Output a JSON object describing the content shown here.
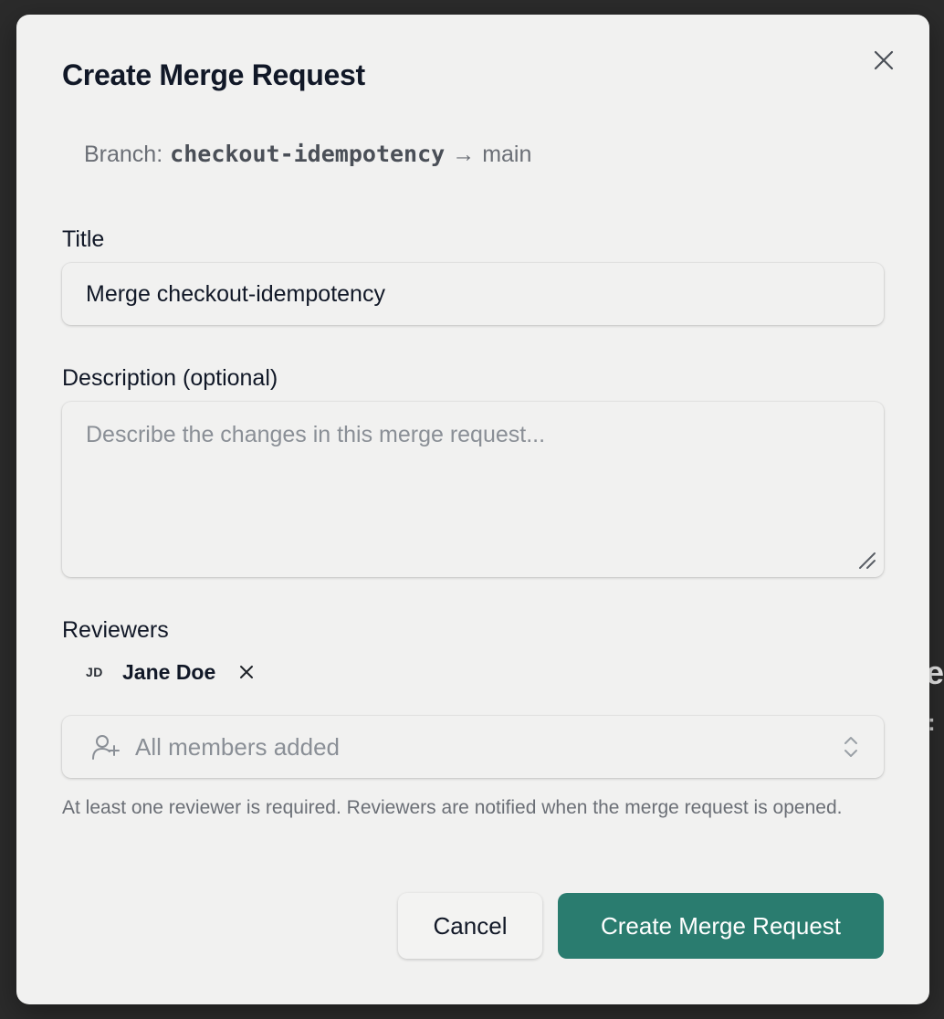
{
  "background": {
    "fragment_1": "e",
    "fragment_2": ": "
  },
  "modal": {
    "title": "Create Merge Request",
    "close_icon": "close-icon",
    "branch": {
      "prefix": "Branch:",
      "source": "checkout-idempotency",
      "arrow": "→",
      "target": "main"
    },
    "title_field": {
      "label": "Title",
      "value": "Merge checkout-idempotency"
    },
    "description_field": {
      "label": "Description (optional)",
      "placeholder": "Describe the changes in this merge request..."
    },
    "reviewers": {
      "label": "Reviewers",
      "selected": [
        {
          "initials": "JD",
          "name": "Jane Doe"
        }
      ],
      "select_placeholder": "All members added",
      "select_icon": "user-plus-icon",
      "help": "At least one reviewer is required. Reviewers are notified when the merge request is opened."
    },
    "actions": {
      "cancel_label": "Cancel",
      "create_label": "Create Merge Request"
    }
  },
  "colors": {
    "accent": "#2a7c6f",
    "modal_bg": "#f1f1f0",
    "backdrop": "#2b2b2b"
  }
}
